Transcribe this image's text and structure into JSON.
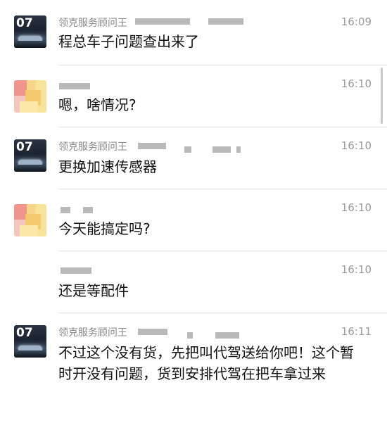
{
  "messages": [
    {
      "sender": "领克服务顾问王",
      "time": "16:09",
      "text": "程总车子问题查出来了",
      "avatar": "brand-car-avatar",
      "avatar_label": "07"
    },
    {
      "sender": "",
      "time": "16:10",
      "text": "嗯，啥情况?",
      "avatar": "blurred-avatar"
    },
    {
      "sender": "领克服务顾问王",
      "time": "16:10",
      "text": "更换加速传感器",
      "avatar": "brand-car-avatar",
      "avatar_label": "07"
    },
    {
      "sender": "",
      "time": "16:10",
      "text": "今天能搞定吗?",
      "avatar": "blurred-avatar"
    },
    {
      "sender": "",
      "time": "16:10",
      "text": "还是等配件",
      "avatar": "none"
    },
    {
      "sender": "领克服务顾问王",
      "time": "16:11",
      "text": "不过这个没有货，先把叫代驾送给你吧！这个暂时开没有问题，货到安排代驾在把车拿过来",
      "avatar": "brand-car-avatar",
      "avatar_label": "07"
    }
  ],
  "colors": {
    "background": "#ffffff",
    "text": "#111111",
    "meta": "#8a8a8a"
  }
}
